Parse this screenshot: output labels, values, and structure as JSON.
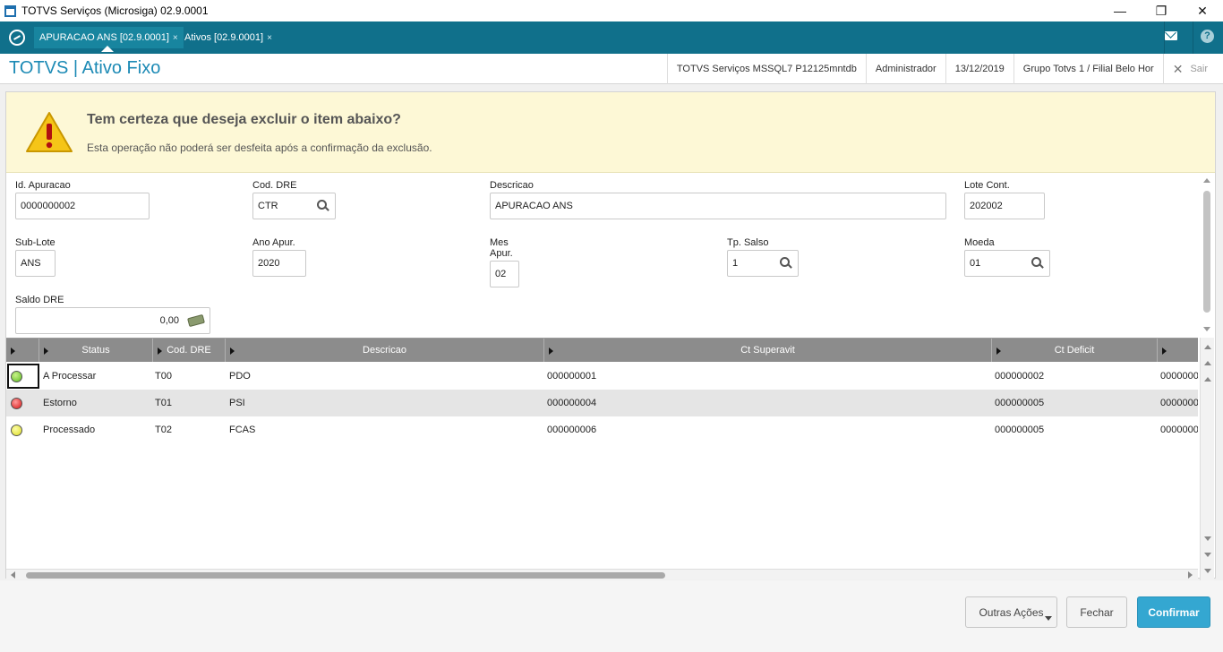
{
  "window": {
    "title": "TOTVS Serviços (Microsiga) 02.9.0001",
    "minimize": "—",
    "restore": "❐",
    "close": "✕"
  },
  "tabs": [
    {
      "label": "APURACAO ANS [02.9.0001]",
      "close": "×"
    },
    {
      "label": "Ativos [02.9.0001]",
      "close": "×"
    }
  ],
  "header": {
    "module": "TOTVS | Ativo Fixo",
    "environment": "TOTVS Serviços MSSQL7 P12125mntdb",
    "user": "Administrador",
    "date": "13/12/2019",
    "branch": "Grupo Totvs 1 / Filial Belo Hor",
    "exit_icon": "✕",
    "exit_label": "Sair",
    "help_glyph": "?"
  },
  "warning": {
    "icon": "warning-triangle-icon",
    "title": "Tem certeza que deseja excluir o item abaixo?",
    "subtitle": "Esta operação não poderá ser desfeita após a confirmação da exclusão."
  },
  "form": {
    "id_apuracao": {
      "label": "Id. Apuracao",
      "value": "0000000002"
    },
    "cod_dre": {
      "label": "Cod. DRE",
      "value": "CTR"
    },
    "descricao": {
      "label": "Descricao",
      "value": "APURACAO ANS"
    },
    "lote_cont": {
      "label": "Lote Cont.",
      "value": "202002"
    },
    "sub_lote": {
      "label": "Sub-Lote",
      "value": "ANS"
    },
    "ano_apur": {
      "label": "Ano Apur.",
      "value": "2020"
    },
    "mes_apur": {
      "label": "Mes Apur.",
      "value": "02"
    },
    "tp_salso": {
      "label": "Tp. Salso",
      "value": "1"
    },
    "moeda": {
      "label": "Moeda",
      "value": "01"
    },
    "saldo_dre": {
      "label": "Saldo DRE",
      "value": "0,00"
    }
  },
  "grid": {
    "columns": [
      "Status",
      "Cod. DRE",
      "Descricao",
      "Ct Superavit",
      "Ct Deficit"
    ],
    "rows": [
      {
        "color": "green",
        "status": "A Processar",
        "cod": "T00",
        "desc": "PDO",
        "superavit": "000000001",
        "deficit": "000000002",
        "extra": "0000000"
      },
      {
        "color": "red",
        "status": "Estorno",
        "cod": "T01",
        "desc": "PSI",
        "superavit": "000000004",
        "deficit": "000000005",
        "extra": "0000000"
      },
      {
        "color": "yellow",
        "status": "Processado",
        "cod": "T02",
        "desc": "FCAS",
        "superavit": "000000006",
        "deficit": "000000005",
        "extra": "0000000"
      }
    ]
  },
  "footer": {
    "other_actions": "Outras Ações",
    "close": "Fechar",
    "confirm": "Confirmar"
  }
}
